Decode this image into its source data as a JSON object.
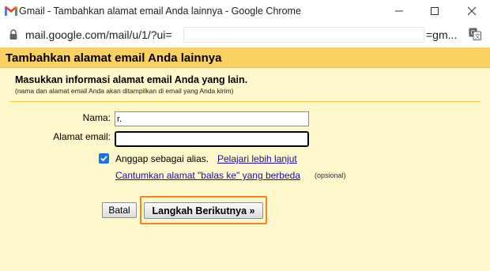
{
  "window": {
    "title": "Gmail - Tambahkan alamat email Anda lainnya - Google Chrome",
    "logo_icon": "gmail-logo-icon"
  },
  "address_bar": {
    "url": "mail.google.com/mail/u/1/?ui=",
    "url_tail": "=gm..."
  },
  "page": {
    "title": "Tambahkan alamat email Anda lainnya",
    "subtitle": "Masukkan informasi alamat email Anda yang lain.",
    "note": "(nama dan alamat email Anda akan ditampilkan di email yang Anda kirim)"
  },
  "form": {
    "name_label": "Nama:",
    "name_value": "r.",
    "email_label": "Alamat email:",
    "email_value": "",
    "alias_checked": true,
    "alias_label": "Anggap sebagai alias.",
    "alias_link": "Pelajari lebih lanjut",
    "reply_to_link": "Cantumkan alamat \"balas ke\" yang berbeda",
    "reply_to_optional": "(opsional)"
  },
  "buttons": {
    "cancel": "Batal",
    "next": "Langkah Berikutnya »"
  },
  "colors": {
    "header": "#fad163",
    "background": "#fff7cc",
    "link": "#1a0dab",
    "checkbox": "#1a73e8",
    "highlight": "#f5841f"
  }
}
